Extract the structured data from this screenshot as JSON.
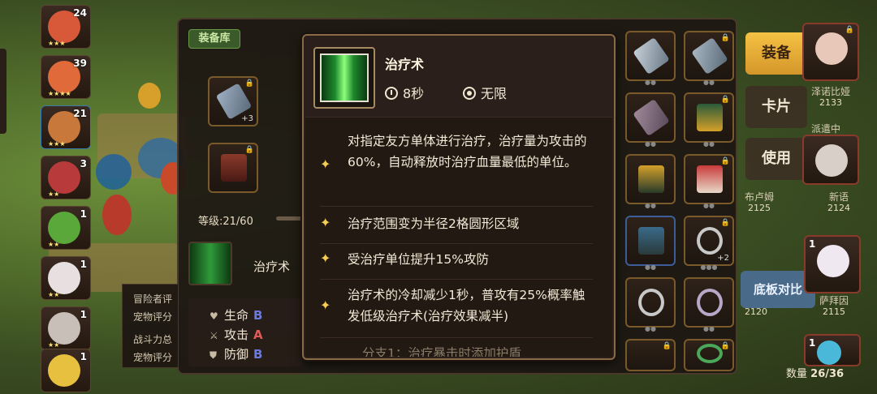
{
  "hero_column": {
    "levels": [
      "24",
      "39",
      "21",
      "3",
      "1",
      "1",
      "1",
      "1"
    ]
  },
  "equipment_panel": {
    "tab_label": "装备库",
    "level_text": "等级:21/60",
    "slot_plus_text": "+3",
    "skill_label": "治疗术",
    "stats": [
      {
        "label": "生命",
        "grade": "B",
        "grade_color": "#6a7ae0"
      },
      {
        "label": "攻击",
        "grade": "A",
        "grade_color": "#e05a5a"
      },
      {
        "label": "防御",
        "grade": "B",
        "grade_color": "#6a7ae0"
      }
    ],
    "desc_lines": [
      "冒险者评",
      "宠物评分",
      "战斗力总",
      "宠物评分"
    ]
  },
  "right_panel": {
    "equip_button": "装备",
    "card_button": "卡片",
    "use_button": "使用",
    "compare_button": "底板对比",
    "quantity_label": "数量",
    "quantity_value": "26/36",
    "slot_plus_text": "+2",
    "portraits": [
      {
        "num": "",
        "name": "泽诺比娅",
        "score": "2133"
      },
      {
        "num": "",
        "name": "派遣中",
        "score": ""
      },
      {
        "num": "",
        "name": "布卢姆",
        "score": "2125"
      },
      {
        "num": "",
        "name": "新语",
        "score": "2124"
      },
      {
        "num": "1",
        "name": "萨拜因",
        "score": "2115"
      },
      {
        "num": "1",
        "name": "",
        "score": "2120"
      }
    ]
  },
  "tooltip": {
    "skill_name": "治疗术",
    "cooldown": "8秒",
    "range": "无限",
    "effects": [
      "对指定友方单体进行治疗，治疗量为攻击的60%，自动释放时治疗血量最低的单位。",
      "治疗范围变为半径2格圆形区域",
      "受治疗单位提升15%攻防",
      "治疗术的冷却减少1秒，普攻有25%概率触发低级治疗术(治疗效果减半)",
      "分支1：治疗暴击时添加护盾"
    ]
  },
  "colors": {
    "tooltip_border": "#8a6a44",
    "accent_gold": "#f6cf52",
    "button_gold": "#f5c244"
  }
}
